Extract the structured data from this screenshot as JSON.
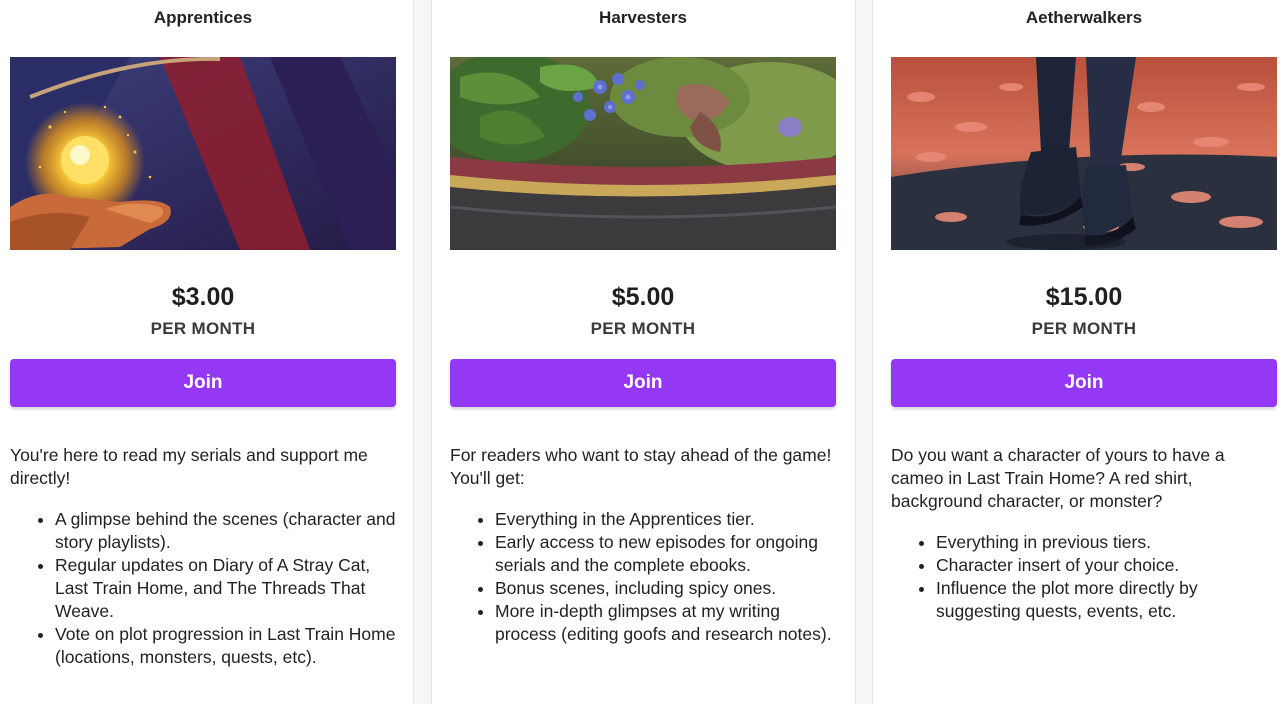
{
  "tiers": [
    {
      "title": "Apprentices",
      "image": "glowing-orb-in-hand",
      "price": "$3.00",
      "period": "PER MONTH",
      "button": "Join",
      "intro": "You're here to read my serials and support me directly!",
      "benefits": [
        "A glimpse behind the scenes (character and story playlists).",
        "Regular updates on Diary of A Stray Cat, Last Train Home, and The Threads That Weave.",
        "Vote on plot progression in Last Train Home (locations, monsters, quests, etc)."
      ]
    },
    {
      "title": "Harvesters",
      "image": "garden-planter-flowers",
      "price": "$5.00",
      "period": "PER MONTH",
      "button": "Join",
      "intro": "For readers who want to stay ahead of the game! You'll get:",
      "benefits": [
        "Everything in the Apprentices tier.",
        "Early access to new episodes for ongoing serials and the complete ebooks.",
        "Bonus scenes, including spicy ones.",
        "More in-depth glimpses at my writing process (editing goofs and research notes)."
      ]
    },
    {
      "title": "Aetherwalkers",
      "image": "walking-on-petals",
      "price": "$15.00",
      "period": "PER MONTH",
      "button": "Join",
      "intro": "Do you want a character of yours to have a cameo in Last Train Home? A red shirt, background character, or monster?",
      "benefits": [
        "Everything in previous tiers.",
        "Character insert of your choice.",
        "Influence the plot more directly by suggesting quests, events, etc."
      ]
    }
  ],
  "colors": {
    "button": "#9438f5",
    "background": "#f6f6f7",
    "card": "#ffffff"
  }
}
